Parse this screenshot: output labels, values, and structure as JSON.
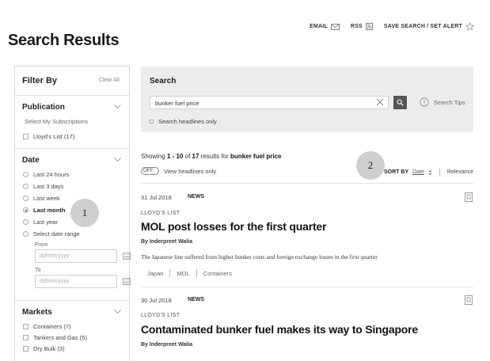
{
  "header": {
    "email_label": "EMAIL",
    "rss_label": "RSS",
    "save_label": "SAVE SEARCH / SET ALERT",
    "page_title": "Search Results"
  },
  "sidebar": {
    "title": "Filter By",
    "clear_all": "Clear All",
    "publication": {
      "title": "Publication",
      "select_subs": "Select My Subscriptions",
      "items": [
        {
          "label": "Lloyd's List (17)",
          "checked": false
        }
      ]
    },
    "date": {
      "title": "Date",
      "options": [
        {
          "label": "Last 24 hours",
          "selected": false
        },
        {
          "label": "Last 3 days",
          "selected": false
        },
        {
          "label": "Last week",
          "selected": false
        },
        {
          "label": "Last month",
          "selected": true
        },
        {
          "label": "Last year",
          "selected": false
        },
        {
          "label": "Select date range",
          "selected": false
        }
      ],
      "from_label": "From",
      "to_label": "To",
      "from_placeholder": "dd/mm/yyyy",
      "to_placeholder": "dd/mm/yyyy"
    },
    "markets": {
      "title": "Markets",
      "items": [
        {
          "label": "Containers (7)",
          "checked": false
        },
        {
          "label": "Tankers and Gas (5)",
          "checked": false
        },
        {
          "label": "Dry Bulk (3)",
          "checked": false
        }
      ]
    }
  },
  "search": {
    "title": "Search",
    "query": "bunker fuel price",
    "tips_label": "Search Tips",
    "headlines_only_label": "Search headlines only"
  },
  "results_bar": {
    "showing_prefix": "Showing",
    "range": "1 - 10",
    "of": "of",
    "total": "17",
    "results_for": "results for",
    "query": "bunker fuel price",
    "toggle_state": "OFF",
    "view_headlines_label": "View headlines only",
    "sort_by_label": "SORT BY",
    "sort_date": "Date",
    "sort_relevance": "Relevance"
  },
  "results": [
    {
      "date": "31 Jul 2018",
      "type": "NEWS",
      "source": "LLOYD'S LIST",
      "title": "MOL post losses for the first quarter",
      "author": "By Inderpreet Walia",
      "snippet": "The Japanese line suffered from higher bunker costs and foreign exchange losses in the first quarter",
      "tags": [
        "Japan",
        "MOL",
        "Containers"
      ]
    },
    {
      "date": "30 Jul 2018",
      "type": "NEWS",
      "source": "LLOYD'S LIST",
      "title": "Contaminated bunker fuel makes its way to Singapore",
      "author": "By Inderpreet Walia"
    }
  ],
  "annotations": [
    "1",
    "2"
  ],
  "colors": {
    "search_panel_bg": "#ececec",
    "search_button": "#555555",
    "annotation": "#cfcfcf"
  }
}
